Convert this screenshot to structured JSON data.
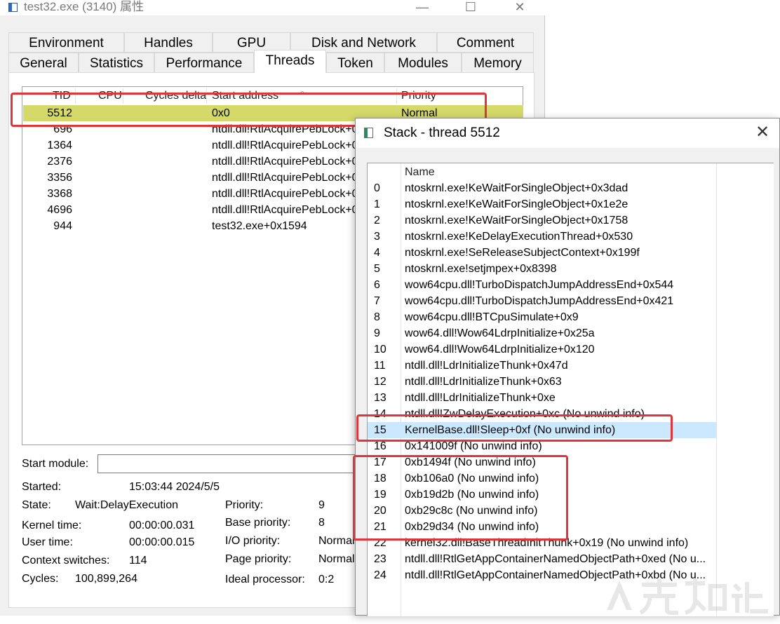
{
  "window": {
    "title": "test32.exe (3140) 属性",
    "controls": [
      "—",
      "☐",
      "✕"
    ]
  },
  "tabs": {
    "row1": [
      "Environment",
      "Handles",
      "GPU",
      "Disk and Network",
      "Comment"
    ],
    "row2": [
      "General",
      "Statistics",
      "Performance",
      "Threads",
      "Token",
      "Modules",
      "Memory"
    ]
  },
  "threads": {
    "columns": [
      "TID",
      "CPU",
      "Cycles delta",
      "Start address",
      "Priority"
    ],
    "rows": [
      {
        "tid": "5512",
        "addr": "0x0",
        "prio": "Normal"
      },
      {
        "tid": "696",
        "addr": "ntdll.dll!RtlAcquirePebLock+0",
        "prio": ""
      },
      {
        "tid": "1364",
        "addr": "ntdll.dll!RtlAcquirePebLock+0",
        "prio": ""
      },
      {
        "tid": "2376",
        "addr": "ntdll.dll!RtlAcquirePebLock+0",
        "prio": ""
      },
      {
        "tid": "3356",
        "addr": "ntdll.dll!RtlAcquirePebLock+0",
        "prio": ""
      },
      {
        "tid": "3368",
        "addr": "ntdll.dll!RtlAcquirePebLock+0",
        "prio": ""
      },
      {
        "tid": "4696",
        "addr": "ntdll.dll!RtlAcquirePebLock+0",
        "prio": ""
      },
      {
        "tid": "944",
        "addr": "test32.exe+0x1594",
        "prio": ""
      }
    ]
  },
  "details": {
    "start_module_label": "Start module:",
    "started_label": "Started:",
    "started_value": "15:03:44 2024/5/5",
    "state_label": "State:",
    "state_value": "Wait:DelayExecution",
    "kernel_label": "Kernel time:",
    "kernel_value": "00:00:00.031",
    "user_label": "User time:",
    "user_value": "00:00:00.015",
    "ctx_label": "Context switches:",
    "ctx_value": "114",
    "cycles_label": "Cycles:",
    "cycles_value": "100,899,264",
    "priority_label": "Priority:",
    "priority_value": "9",
    "base_priority_label": "Base priority:",
    "base_priority_value": "8",
    "io_priority_label": "I/O priority:",
    "io_priority_value": "Normal",
    "page_priority_label": "Page priority:",
    "page_priority_value": "Normal",
    "ideal_label": "Ideal processor:",
    "ideal_value": "0:2"
  },
  "stack": {
    "title": "Stack - thread 5512",
    "close": "✕",
    "column_name": "Name",
    "frames": [
      {
        "n": "0",
        "name": "ntoskrnl.exe!KeWaitForSingleObject+0x3dad"
      },
      {
        "n": "1",
        "name": "ntoskrnl.exe!KeWaitForSingleObject+0x1e2e"
      },
      {
        "n": "2",
        "name": "ntoskrnl.exe!KeWaitForSingleObject+0x1758"
      },
      {
        "n": "3",
        "name": "ntoskrnl.exe!KeDelayExecutionThread+0x530"
      },
      {
        "n": "4",
        "name": "ntoskrnl.exe!SeReleaseSubjectContext+0x199f"
      },
      {
        "n": "5",
        "name": "ntoskrnl.exe!setjmpex+0x8398"
      },
      {
        "n": "6",
        "name": "wow64cpu.dll!TurboDispatchJumpAddressEnd+0x544"
      },
      {
        "n": "7",
        "name": "wow64cpu.dll!TurboDispatchJumpAddressEnd+0x421"
      },
      {
        "n": "8",
        "name": "wow64cpu.dll!BTCpuSimulate+0x9"
      },
      {
        "n": "9",
        "name": "wow64.dll!Wow64LdrpInitialize+0x25a"
      },
      {
        "n": "10",
        "name": "wow64.dll!Wow64LdrpInitialize+0x120"
      },
      {
        "n": "11",
        "name": "ntdll.dll!LdrInitializeThunk+0x47d"
      },
      {
        "n": "12",
        "name": "ntdll.dll!LdrInitializeThunk+0x63"
      },
      {
        "n": "13",
        "name": "ntdll.dll!LdrInitializeThunk+0xe"
      },
      {
        "n": "14",
        "name": "ntdll.dll!ZwDelayExecution+0xc (No unwind info)"
      },
      {
        "n": "15",
        "name": "KernelBase.dll!Sleep+0xf (No unwind info)"
      },
      {
        "n": "16",
        "name": "0x141009f (No unwind info)"
      },
      {
        "n": "17",
        "name": "0xb1494f (No unwind info)"
      },
      {
        "n": "18",
        "name": "0xb106a0 (No unwind info)"
      },
      {
        "n": "19",
        "name": "0xb19d2b (No unwind info)"
      },
      {
        "n": "20",
        "name": "0xb29c8c (No unwind info)"
      },
      {
        "n": "21",
        "name": "0xb29d34 (No unwind info)"
      },
      {
        "n": "22",
        "name": "kernel32.dll!BaseThreadInitThunk+0x19 (No unwind info)"
      },
      {
        "n": "23",
        "name": "ntdll.dll!RtlGetAppContainerNamedObjectPath+0xed (No u..."
      },
      {
        "n": "24",
        "name": "ntdll.dll!RtlGetAppContainerNamedObjectPath+0xbd (No u..."
      }
    ]
  },
  "watermark": "先知社区",
  "colors": {
    "selected_thread": "#d5d96a",
    "selected_frame": "#cce8ff",
    "annotation": "#e0353b"
  }
}
